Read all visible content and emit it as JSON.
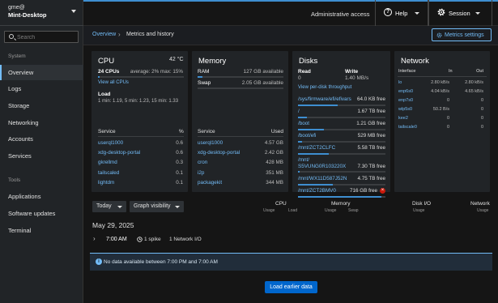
{
  "host": {
    "user": "gme@",
    "name": "Mint-Desktop"
  },
  "search": {
    "placeholder": "Search"
  },
  "sidebar": {
    "system_label": "System",
    "tools_label": "Tools",
    "system_items": [
      "Overview",
      "Logs",
      "Storage",
      "Networking",
      "Accounts",
      "Services"
    ],
    "tool_items": [
      "Applications",
      "Software updates",
      "Terminal"
    ],
    "active": "Overview"
  },
  "topbar": {
    "admin": "Administrative access",
    "help": "Help",
    "session": "Session"
  },
  "breadcrumb": {
    "overview": "Overview",
    "current": "Metrics and history",
    "settings": "Metrics settings"
  },
  "cpu": {
    "title": "CPU",
    "temp": "42 °C",
    "cores": "24 CPUs",
    "usage": "average: 2% max: 15%",
    "usage_fraction": 0.02,
    "view_all": "View all CPUs",
    "load_label": "Load",
    "load": "1 min: 1.19, 5 min: 1.23, 15 min: 1.33",
    "col_service": "Service",
    "col_pct": "%",
    "rows": [
      {
        "name": "userql1000",
        "value": "0.6"
      },
      {
        "name": "xdg-desktop-portal",
        "value": "0.6"
      },
      {
        "name": "gkrellmd",
        "value": "0.3"
      },
      {
        "name": "tailscaled",
        "value": "0.1"
      },
      {
        "name": "lightdm",
        "value": "0.1"
      }
    ]
  },
  "memory": {
    "title": "Memory",
    "ram_label": "RAM",
    "ram_value": "127 GB available",
    "ram_fraction": 0.06,
    "swap_label": "Swap",
    "swap_value": "2.05 GB available",
    "swap_fraction": 0.0,
    "col_service": "Service",
    "col_used": "Used",
    "rows": [
      {
        "name": "userql1000",
        "value": "4.57 GB"
      },
      {
        "name": "xdg-desktop-portal",
        "value": "2.42 GB"
      },
      {
        "name": "cron",
        "value": "428 MB"
      },
      {
        "name": "i2p",
        "value": "351 MB"
      },
      {
        "name": "packagekit",
        "value": "344 MB"
      }
    ]
  },
  "disks": {
    "title": "Disks",
    "read_label": "Read",
    "read_value": "0",
    "write_label": "Write",
    "write_value": "1.40 MB/s",
    "per_disk": "View per-disk throughput",
    "rows": [
      {
        "path": "/sys/firmware/efi/efivars",
        "free": "64.0 KB free",
        "used_fraction": 0.45
      },
      {
        "path": "/",
        "free": "1.67 TB free",
        "used_fraction": 0.1
      },
      {
        "path": "/boot",
        "free": "1.21 GB free",
        "used_fraction": 0.3
      },
      {
        "path": "/boot/efi",
        "free": "529 MB free",
        "used_fraction": 0.05
      },
      {
        "path": "/mnt/ZCT2CLFC",
        "free": "5.58 TB free",
        "used_fraction": 0.35
      },
      {
        "path": "/mnt/\nS5VUNG0R103220X",
        "free": "7.30 TB free",
        "used_fraction": 0.02
      },
      {
        "path": "/mnt/WX11D587J52N",
        "free": "4.75 TB free",
        "used_fraction": 0.4
      },
      {
        "path": "/mnt/ZCT2BMV0",
        "free": "716 GB free",
        "used_fraction": 0.95,
        "warning": true
      }
    ]
  },
  "network": {
    "title": "Network",
    "col_interface": "Interface",
    "col_in": "In",
    "col_out": "Out",
    "rows": [
      {
        "name": "lo",
        "in": "2.80 kB/s",
        "out": "2.80 kB/s"
      },
      {
        "name": "enp6s0",
        "in": "4.04 kB/s",
        "out": "4.65 kB/s"
      },
      {
        "name": "enp7s0",
        "in": "0",
        "out": "0"
      },
      {
        "name": "wlp5s0",
        "in": "50.2 B/s",
        "out": "0"
      },
      {
        "name": "kee2",
        "in": "0",
        "out": "0"
      },
      {
        "name": "tailscale0",
        "in": "0",
        "out": "0"
      }
    ]
  },
  "graphs": {
    "range": "Today",
    "visibility": "Graph visibility",
    "columns": [
      {
        "title": "CPU",
        "subs": [
          "Usage",
          "Load"
        ]
      },
      {
        "title": "Memory",
        "subs": [
          "Usage",
          "Swap"
        ]
      },
      {
        "title": "Disk I/O",
        "subs": [
          "Usage"
        ]
      },
      {
        "title": "Network",
        "subs": [
          "Usage"
        ]
      }
    ],
    "date": "May 29, 2025",
    "event_time": "7:00 AM",
    "event_spike": "1 spike",
    "event_desc": "1 Network I/O",
    "info": "No data available between 7:00 PM and 7:00 AM",
    "load_earlier": "Load earlier data"
  },
  "colors": {
    "accent": "#73bcf7",
    "primary": "#0066cc",
    "danger": "#c9190b"
  }
}
